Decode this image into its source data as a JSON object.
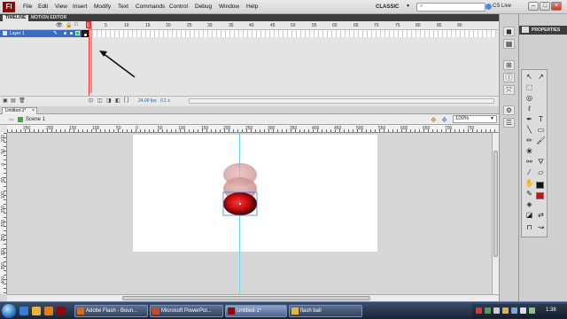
{
  "app": {
    "logo": "Fl"
  },
  "menu": [
    "File",
    "Edit",
    "View",
    "Insert",
    "Modify",
    "Text",
    "Commands",
    "Control",
    "Debug",
    "Window",
    "Help"
  ],
  "workspace": {
    "label": "CLASSIC"
  },
  "cslive": {
    "label": "CS Live"
  },
  "timeline": {
    "tabs": [
      "TIMELINE",
      "MOTION EDITOR"
    ],
    "frame_numbers": [
      "5",
      "10",
      "15",
      "20",
      "25",
      "30",
      "35",
      "40",
      "45",
      "50",
      "55",
      "60",
      "65",
      "70",
      "75",
      "80",
      "85",
      "90"
    ],
    "layer": {
      "name": "Layer 1"
    },
    "fps": "24.00 fps",
    "time": "0.1 s",
    "current_frame": "1"
  },
  "document": {
    "tab": "Untitled-1*",
    "scene": "Scene 1",
    "zoom": "100%"
  },
  "ruler": {
    "top_numbers": [
      "250",
      "200",
      "150",
      "100",
      "50",
      "0",
      "50",
      "100",
      "150",
      "200",
      "250",
      "300",
      "350",
      "400",
      "450",
      "500",
      "550",
      "600",
      "650",
      "700",
      "750"
    ],
    "left_numbers": [
      "100",
      "50",
      "0",
      "50",
      "100",
      "150",
      "200",
      "250",
      "300",
      "350",
      "400"
    ]
  },
  "panels": {
    "properties": "PROPERTIES"
  },
  "taskbar": {
    "items": [
      "Adobe Flash - Boun...",
      "Microsoft PowerPoi...",
      "Untitled-1*",
      "flash ball"
    ],
    "clock": "1:38"
  },
  "colors": {
    "stroke": "#111111",
    "fill": "#c81414",
    "layer_highlight": "#3b6bc4"
  }
}
